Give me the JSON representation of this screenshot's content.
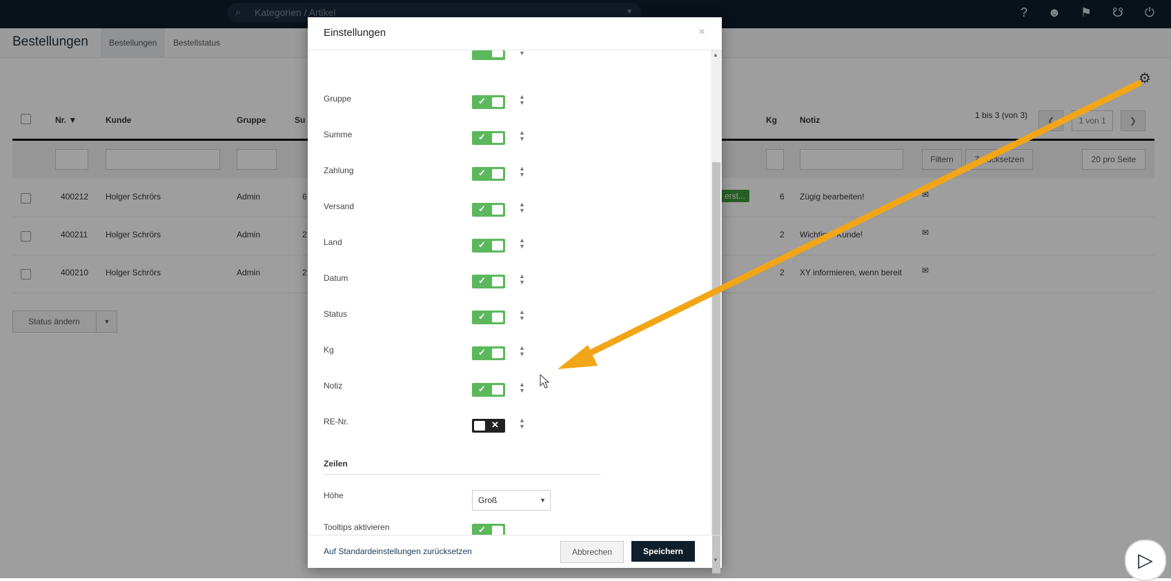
{
  "topbar": {
    "search_placeholder": "Kategorien / Artikel",
    "icons": [
      "question-icon",
      "users-icon",
      "megaphone-icon",
      "cart-icon",
      "power-icon"
    ]
  },
  "subbar": {
    "title": "Bestellungen",
    "tabs": [
      {
        "label": "Bestellungen"
      },
      {
        "label": "Bestellstatus"
      }
    ]
  },
  "table": {
    "columns": [
      "Nr.",
      "Kunde",
      "Gruppe",
      "Su",
      "Kg",
      "Notiz"
    ],
    "pager_text": "1 bis 3 (von 3)",
    "page_select": "1 von 1",
    "filter_label": "Filtern",
    "reset_label": "Zurücksetzen",
    "per_page": "20 pro Seite",
    "rows": [
      {
        "nr": "400212",
        "kunde": "Holger Schrörs",
        "gruppe": "Admin",
        "summe": "6",
        "status": "erst...",
        "kg": "6",
        "notiz": "Zügig bearbeiten!"
      },
      {
        "nr": "400211",
        "kunde": "Holger Schrörs",
        "gruppe": "Admin",
        "summe": "2",
        "kg": "2",
        "notiz": "Wichtiger Kunde!"
      },
      {
        "nr": "400210",
        "kunde": "Holger Schrörs",
        "gruppe": "Admin",
        "summe": "2",
        "kg": "2",
        "notiz": "XY informieren, wenn bereit"
      }
    ],
    "status_change_label": "Status ändern"
  },
  "modal": {
    "title": "Einstellungen",
    "close": "×",
    "columns": [
      {
        "label": "Gruppe",
        "enabled": true
      },
      {
        "label": "Summe",
        "enabled": true
      },
      {
        "label": "Zahlung",
        "enabled": true
      },
      {
        "label": "Versand",
        "enabled": true
      },
      {
        "label": "Land",
        "enabled": true
      },
      {
        "label": "Datum",
        "enabled": true
      },
      {
        "label": "Status",
        "enabled": true
      },
      {
        "label": "Kg",
        "enabled": true
      },
      {
        "label": "Notiz",
        "enabled": true
      },
      {
        "label": "RE-Nr.",
        "enabled": false
      }
    ],
    "rows_section": "Zeilen",
    "height_label": "Höhe",
    "height_value": "Groß",
    "tooltips_label": "Tooltips aktivieren",
    "reset_link": "Auf Standardeinstellungen zurücksetzen",
    "cancel_label": "Abbrechen",
    "save_label": "Speichern"
  },
  "colors": {
    "topbar": "#0f1e2b",
    "toggle_on": "#5cb85c",
    "arrow": "#f2a516",
    "primary_button": "#0f1e2b"
  }
}
